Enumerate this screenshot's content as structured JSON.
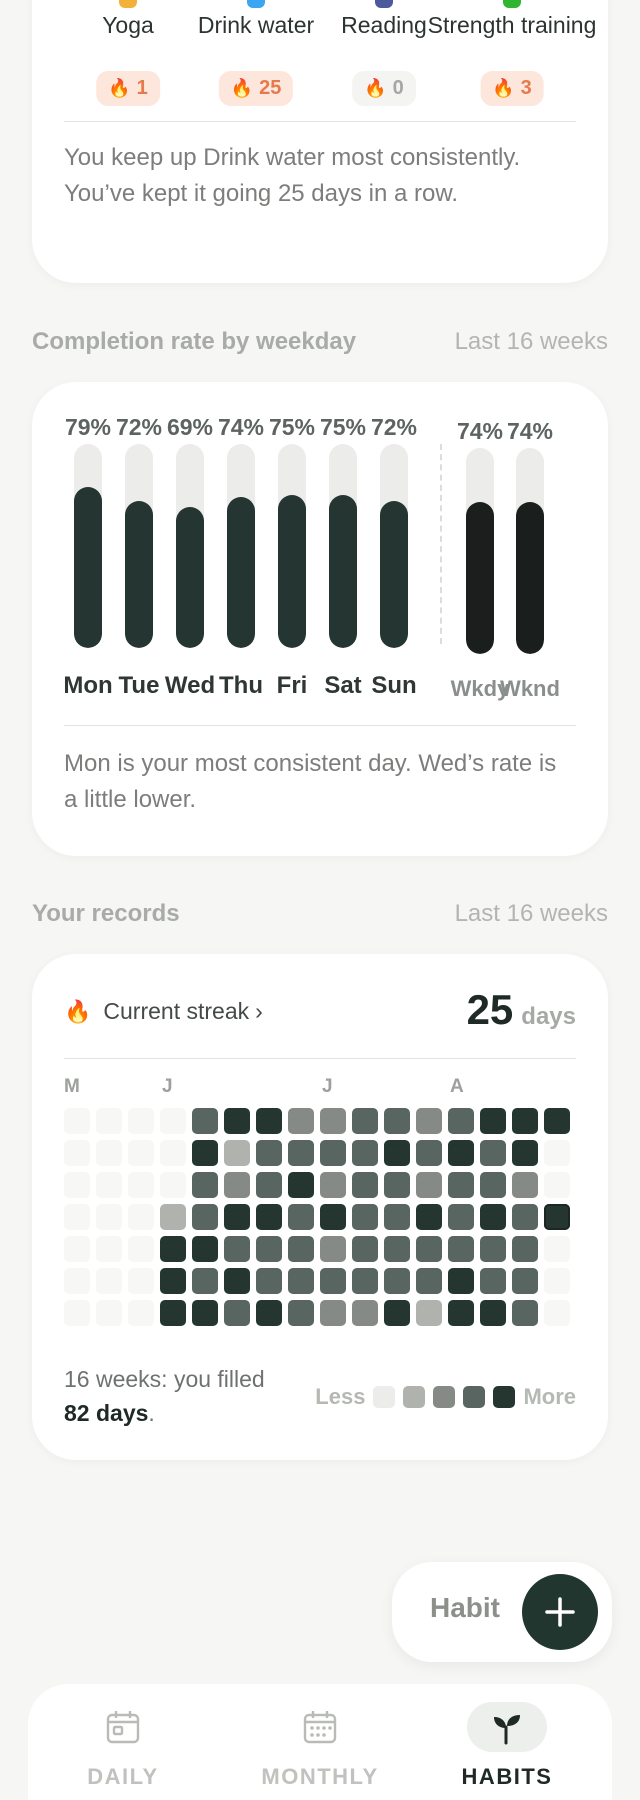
{
  "summary": {
    "habits": [
      {
        "name": "Yoga",
        "streak": "1",
        "icon": "hands-icon",
        "icon_color": "#f2b23a",
        "pill_bg": "#fde6db",
        "pill_fg": "#e67a4c"
      },
      {
        "name": "Drink water",
        "streak": "25",
        "icon": "water-drop-icon",
        "icon_color": "#3aa6f2",
        "pill_bg": "#fde6db",
        "pill_fg": "#e67a4c"
      },
      {
        "name": "Reading",
        "streak": "0",
        "icon": "book-icon",
        "icon_color": "#4b5a9c",
        "pill_bg": "#f4f4f2",
        "pill_fg": "#a5a7a3"
      },
      {
        "name": "Strength training",
        "streak": "3",
        "icon": "dumbbell-icon",
        "icon_color": "#2fb52f",
        "pill_bg": "#fde6db",
        "pill_fg": "#e67a4c"
      }
    ],
    "flame_glyph": "🔥",
    "insight": "You keep up Drink water most consistently. You’ve kept it going 25 days in a row."
  },
  "weekday_section": {
    "title": "Completion rate by weekday",
    "range": "Last 16 weeks"
  },
  "chart_data": {
    "type": "bar",
    "categories": [
      "Mon",
      "Tue",
      "Wed",
      "Thu",
      "Fri",
      "Sat",
      "Sun",
      "Wkdy",
      "Wknd"
    ],
    "values": [
      79,
      72,
      69,
      74,
      75,
      75,
      72,
      74,
      74
    ],
    "value_labels": [
      "79%",
      "72%",
      "69%",
      "74%",
      "75%",
      "75%",
      "72%",
      "74%",
      "74%"
    ],
    "ylim": [
      0,
      100
    ],
    "bar_color": "#253632",
    "summary_bar_color": "#1a1f1d",
    "track_color": "#ececea"
  },
  "weekday_insight": "Mon is your most consistent day. Wed’s rate is a little lower.",
  "records_section": {
    "title": "Your records",
    "range": "Last 16 weeks"
  },
  "records": {
    "streak_label": "Current streak",
    "streak_chevron": "›",
    "streak_value": "25",
    "streak_unit": "days",
    "month_labels": [
      "M",
      "J",
      "J",
      "A"
    ],
    "summary_prefix": "16 weeks: you filled",
    "summary_days": "82 days",
    "summary_suffix": ".",
    "legend_less": "Less",
    "legend_more": "More",
    "legend_colors": [
      "#ececea",
      "#b0b2ae",
      "#868a86",
      "#596560",
      "#25352f"
    ],
    "empty_color": "#f7f7f6",
    "heatmap_levels": [
      [
        0,
        0,
        0,
        0,
        3,
        4,
        4,
        2,
        2,
        3,
        3,
        2,
        3,
        4,
        4,
        4
      ],
      [
        0,
        0,
        0,
        0,
        4,
        1,
        3,
        3,
        3,
        3,
        4,
        3,
        4,
        3,
        4,
        0
      ],
      [
        0,
        0,
        0,
        0,
        3,
        2,
        3,
        4,
        2,
        3,
        3,
        2,
        3,
        3,
        2,
        0
      ],
      [
        0,
        0,
        0,
        1,
        3,
        4,
        4,
        3,
        4,
        3,
        3,
        4,
        3,
        4,
        3,
        4
      ],
      [
        0,
        0,
        0,
        4,
        4,
        3,
        3,
        3,
        2,
        3,
        3,
        3,
        3,
        3,
        3,
        0
      ],
      [
        0,
        0,
        0,
        4,
        3,
        4,
        3,
        3,
        3,
        3,
        3,
        3,
        4,
        3,
        3,
        0
      ],
      [
        0,
        0,
        0,
        4,
        4,
        3,
        4,
        3,
        2,
        2,
        4,
        1,
        4,
        4,
        3,
        0
      ]
    ],
    "today_cell": [
      3,
      15
    ]
  },
  "fab": {
    "label": "Habit",
    "icon": "plus-icon"
  },
  "nav": {
    "items": [
      {
        "label": "DAILY",
        "icon": "daily-calendar-icon"
      },
      {
        "label": "MONTHLY",
        "icon": "monthly-calendar-icon"
      },
      {
        "label": "HABITS",
        "icon": "sprout-icon"
      }
    ],
    "active": "HABITS"
  }
}
